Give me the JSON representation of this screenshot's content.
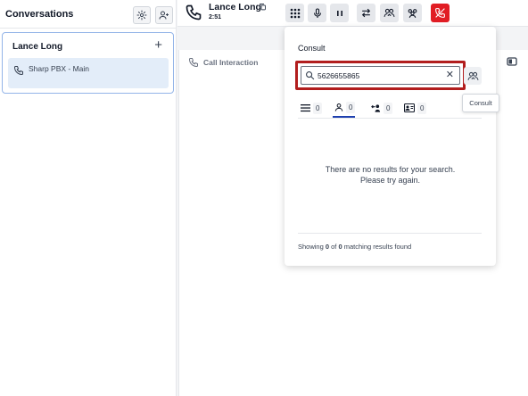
{
  "sidebar": {
    "title": "Conversations",
    "settings_icon": "gear-icon",
    "add_contact_icon": "add-person-icon",
    "conversation": {
      "name": "Lance Long",
      "add_icon": "plus-icon",
      "line_label": "Sharp PBX - Main"
    }
  },
  "topbar": {
    "caller_name": "Lance Long",
    "timer": "2:51",
    "buttons": [
      "dialpad-icon",
      "microphone-icon",
      "pause-icon",
      "transfer-icon",
      "consult-icon",
      "conference-icon",
      "hangup-icon"
    ],
    "hangup_color": "#e11d24"
  },
  "main": {
    "call_interaction_label": "Call Interaction"
  },
  "consult": {
    "title": "Consult",
    "search_value": "5626655865",
    "tabs": [
      {
        "icon": "list-icon",
        "count": "0"
      },
      {
        "icon": "person-icon",
        "count": "0"
      },
      {
        "icon": "queue-icon",
        "count": "0"
      },
      {
        "icon": "contact-card-icon",
        "count": "0"
      }
    ],
    "no_results_line1": "There are no results for your search.",
    "no_results_line2": "Please try again.",
    "footer": {
      "prefix": "Showing ",
      "shown": "0",
      "middle": " of ",
      "total": "0",
      "suffix": " matching results found"
    },
    "tooltip": "Consult",
    "highlight_color": "#b21e1e"
  }
}
